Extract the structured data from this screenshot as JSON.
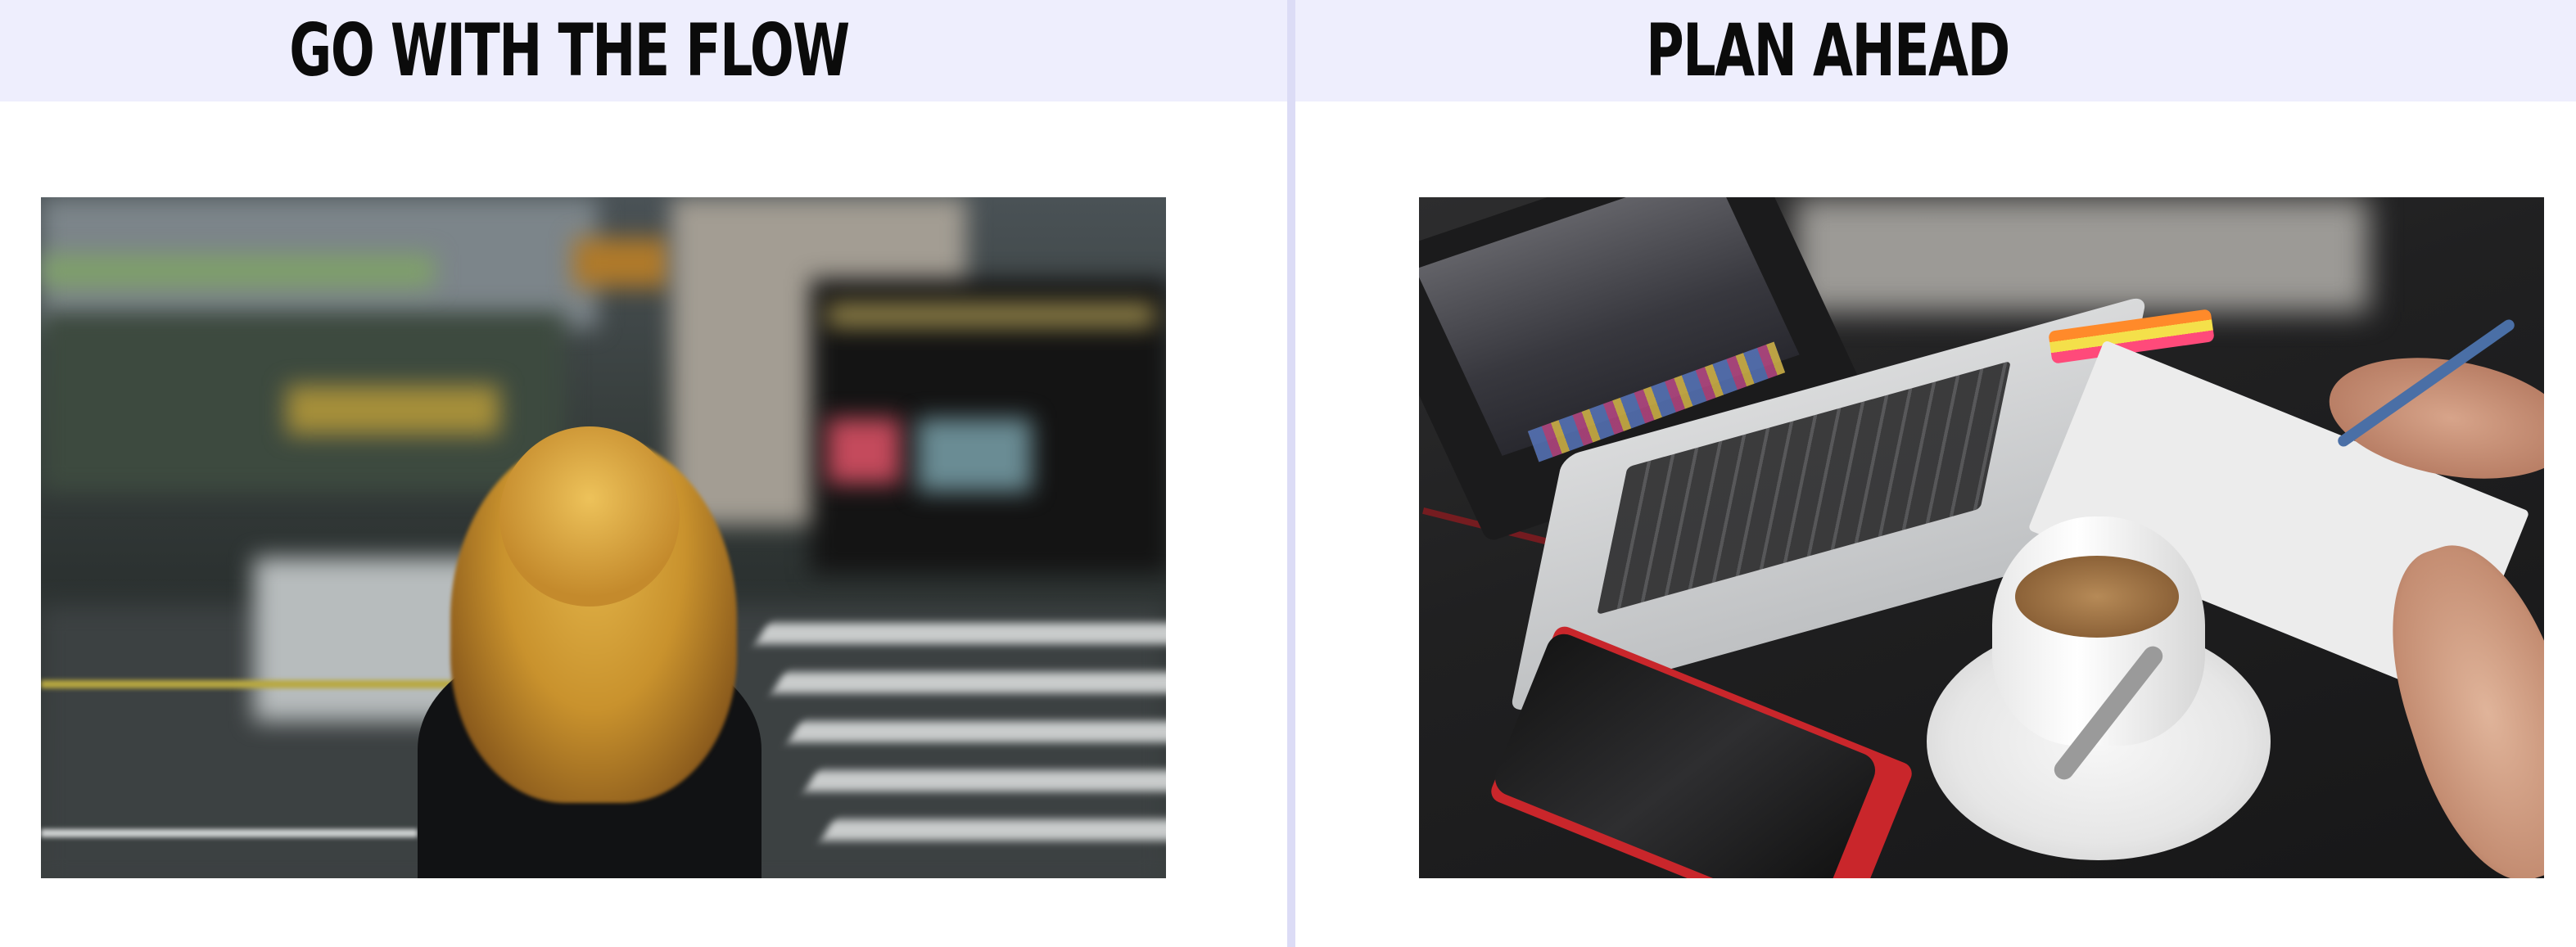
{
  "panels": [
    {
      "heading": "GO WITH THE FLOW",
      "image_subject": "woman with long blonde hair walking across a blurred city crosswalk"
    },
    {
      "heading": "PLAN AHEAD",
      "image_subject": "desk with laptop, notebook, coffee cup and smartphone"
    }
  ],
  "colors": {
    "header_band": "#eeeefd",
    "divider": "#dcdcf6",
    "heading_text": "#0b0b0b",
    "background": "#ffffff"
  }
}
